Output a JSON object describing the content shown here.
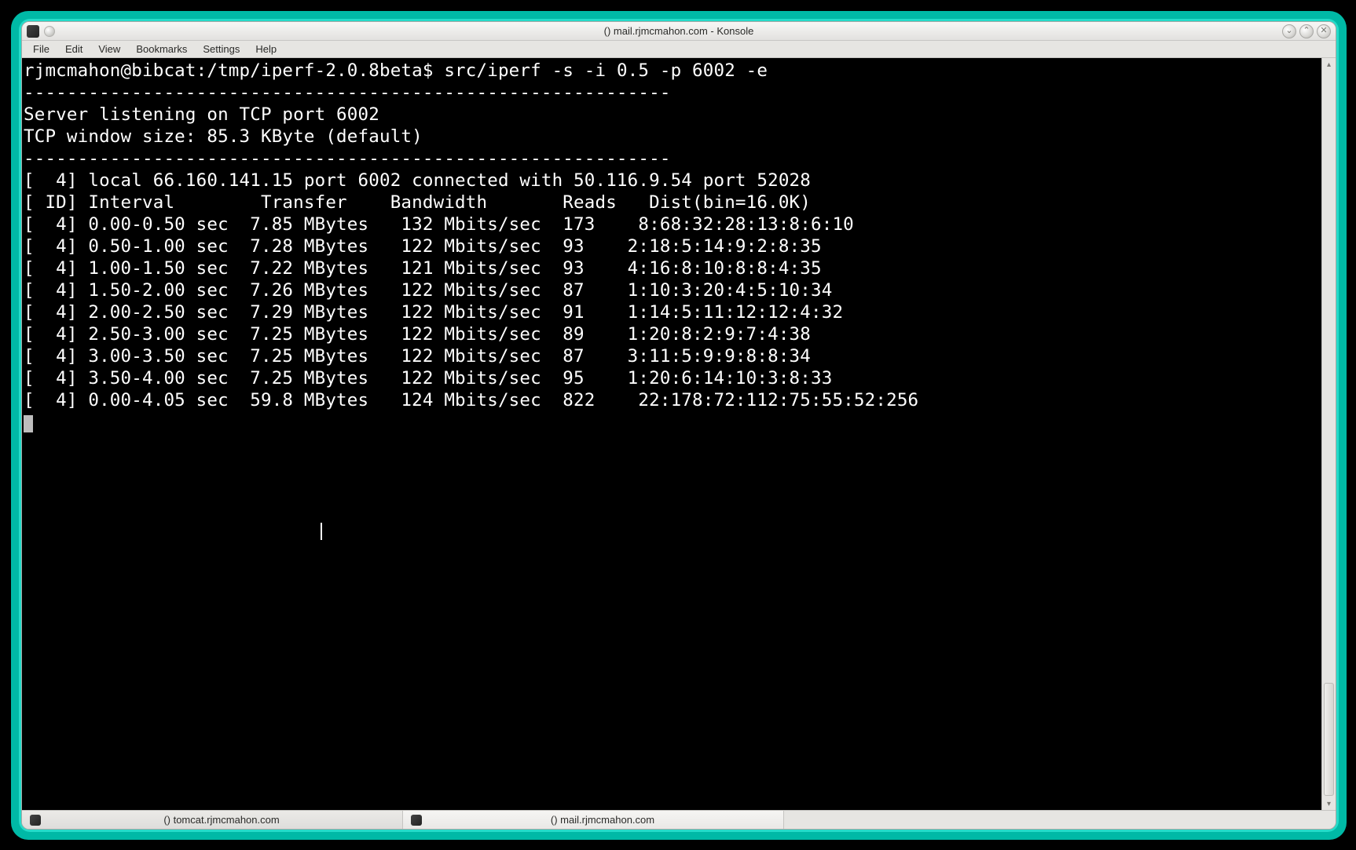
{
  "window": {
    "title": "() mail.rjmcmahon.com - Konsole"
  },
  "menu": {
    "file": "File",
    "edit": "Edit",
    "view": "View",
    "bookmarks": "Bookmarks",
    "settings": "Settings",
    "help": "Help"
  },
  "terminal": {
    "prompt": "rjmcmahon@bibcat:/tmp/iperf-2.0.8beta$ ",
    "command": "src/iperf -s -i 0.5 -p 6002 -e",
    "sep": "------------------------------------------------------------",
    "line_server": "Server listening on TCP port 6002",
    "line_window": "TCP window size: 85.3 KByte (default)",
    "line_conn": "[  4] local 66.160.141.15 port 6002 connected with 50.116.9.54 port 52028",
    "line_header": "[ ID] Interval        Transfer    Bandwidth       Reads   Dist(bin=16.0K)",
    "rows": [
      "[  4] 0.00-0.50 sec  7.85 MBytes   132 Mbits/sec  173    8:68:32:28:13:8:6:10",
      "[  4] 0.50-1.00 sec  7.28 MBytes   122 Mbits/sec  93    2:18:5:14:9:2:8:35",
      "[  4] 1.00-1.50 sec  7.22 MBytes   121 Mbits/sec  93    4:16:8:10:8:8:4:35",
      "[  4] 1.50-2.00 sec  7.26 MBytes   122 Mbits/sec  87    1:10:3:20:4:5:10:34",
      "[  4] 2.00-2.50 sec  7.29 MBytes   122 Mbits/sec  91    1:14:5:11:12:12:4:32",
      "[  4] 2.50-3.00 sec  7.25 MBytes   122 Mbits/sec  89    1:20:8:2:9:7:4:38",
      "[  4] 3.00-3.50 sec  7.25 MBytes   122 Mbits/sec  87    3:11:5:9:9:8:8:34",
      "[  4] 3.50-4.00 sec  7.25 MBytes   122 Mbits/sec  95    1:20:6:14:10:3:8:33",
      "[  4] 0.00-4.05 sec  59.8 MBytes   124 Mbits/sec  822    22:178:72:112:75:55:52:256"
    ]
  },
  "tabs": {
    "t0": "() tomcat.rjmcmahon.com",
    "t1": "() mail.rjmcmahon.com"
  }
}
